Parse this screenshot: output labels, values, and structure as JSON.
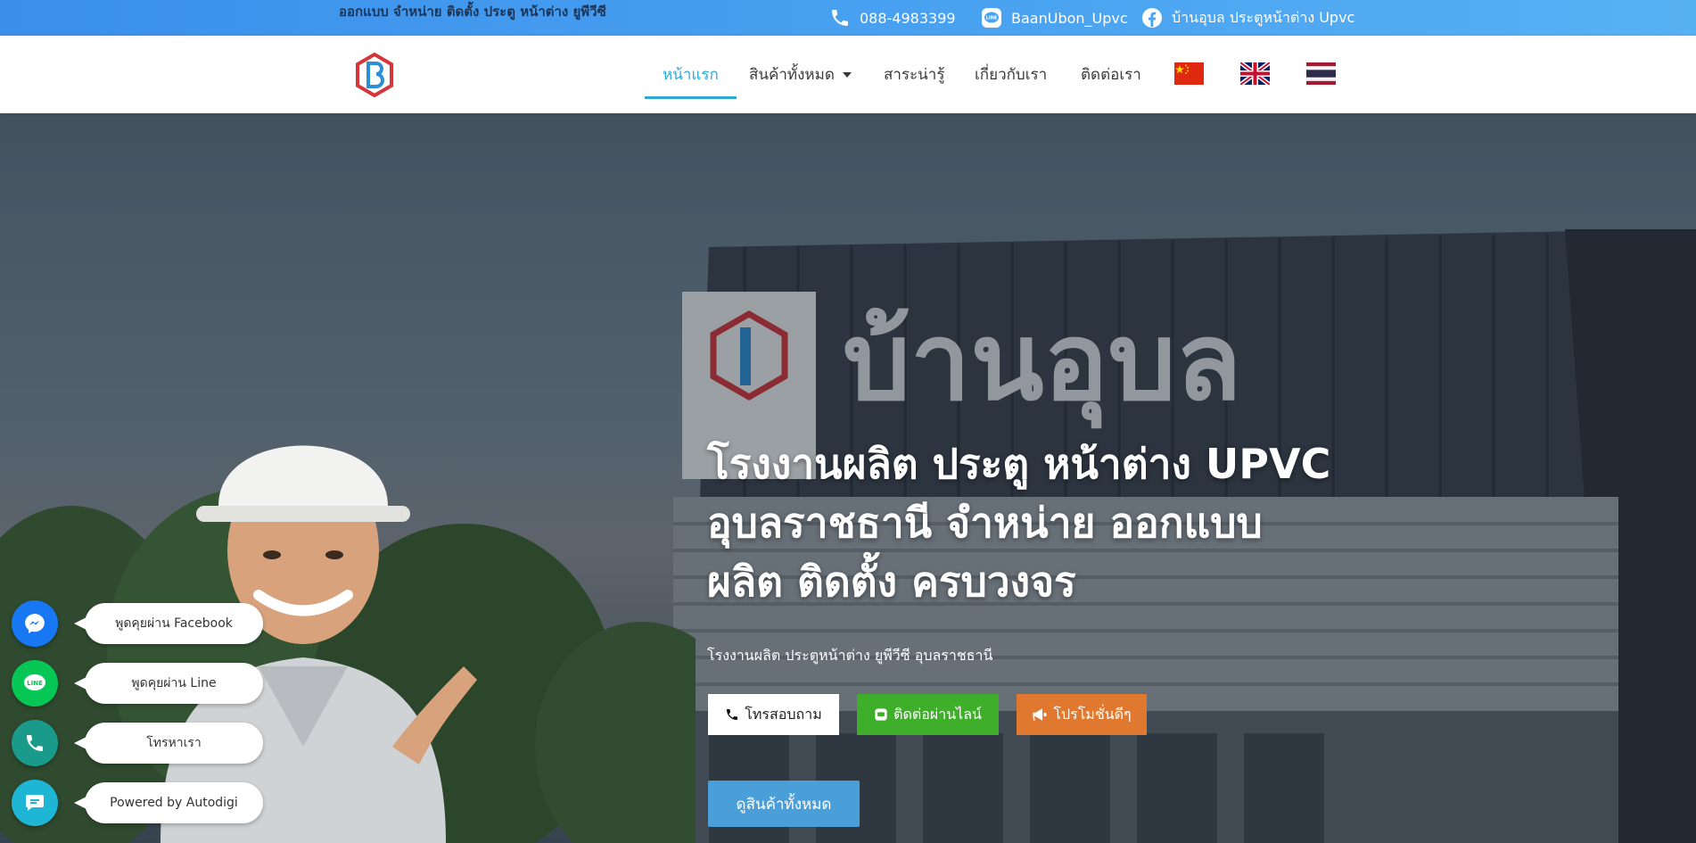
{
  "topbar": {
    "tagline": "ออกแบบ จำหน่าย ติดตั้ง ประตู หน้าต่าง ยูพีวีซี",
    "phone": "088-4983399",
    "line": "BaanUbon_Upvc",
    "facebook": "บ้านอุบล ประตูหน้าต่าง Upvc"
  },
  "nav": {
    "items": [
      {
        "label": "หน้าแรก"
      },
      {
        "label": "สินค้าทั้งหมด"
      },
      {
        "label": "สาระน่ารู้"
      },
      {
        "label": "เกี่ยวกับเรา"
      },
      {
        "label": "ติดต่อเรา"
      }
    ],
    "flags": [
      "china-flag",
      "uk-flag",
      "thailand-flag"
    ]
  },
  "hero": {
    "signboard_text": "บ้านอุบล",
    "title_lines": [
      "โรงงานผลิต ประตู หน้าต่าง UPVC",
      "อุบลราชธานี จำหน่าย ออกแบบ",
      "ผลิต ติดตั้ง ครบวงจร"
    ],
    "subtitle": "โรงงานผลิต ประตูหน้าต่าง ยูพีวีซี อุบลราชธานี",
    "buttons": {
      "call": "โทรสอบถาม",
      "line": "ติดต่อผ่านไลน์",
      "promo": "โปรโมชั่นดีๆ",
      "all_products": "ดูสินค้าทั้งหมด"
    }
  },
  "chat_widgets": [
    {
      "label": "พูดคุยผ่าน Facebook",
      "color": "#1877f2"
    },
    {
      "label": "พูดคุยผ่าน Line",
      "color": "#06c755"
    },
    {
      "label": "โทรหาเรา",
      "color": "#1a9a8a"
    },
    {
      "label": "Powered by Autodigi",
      "color": "#1fb6d6"
    }
  ],
  "colors": {
    "accent": "#2ea8d8",
    "topbar": "#4aa3f1",
    "line_green": "#3fae2a",
    "promo_orange": "#e1782f"
  }
}
